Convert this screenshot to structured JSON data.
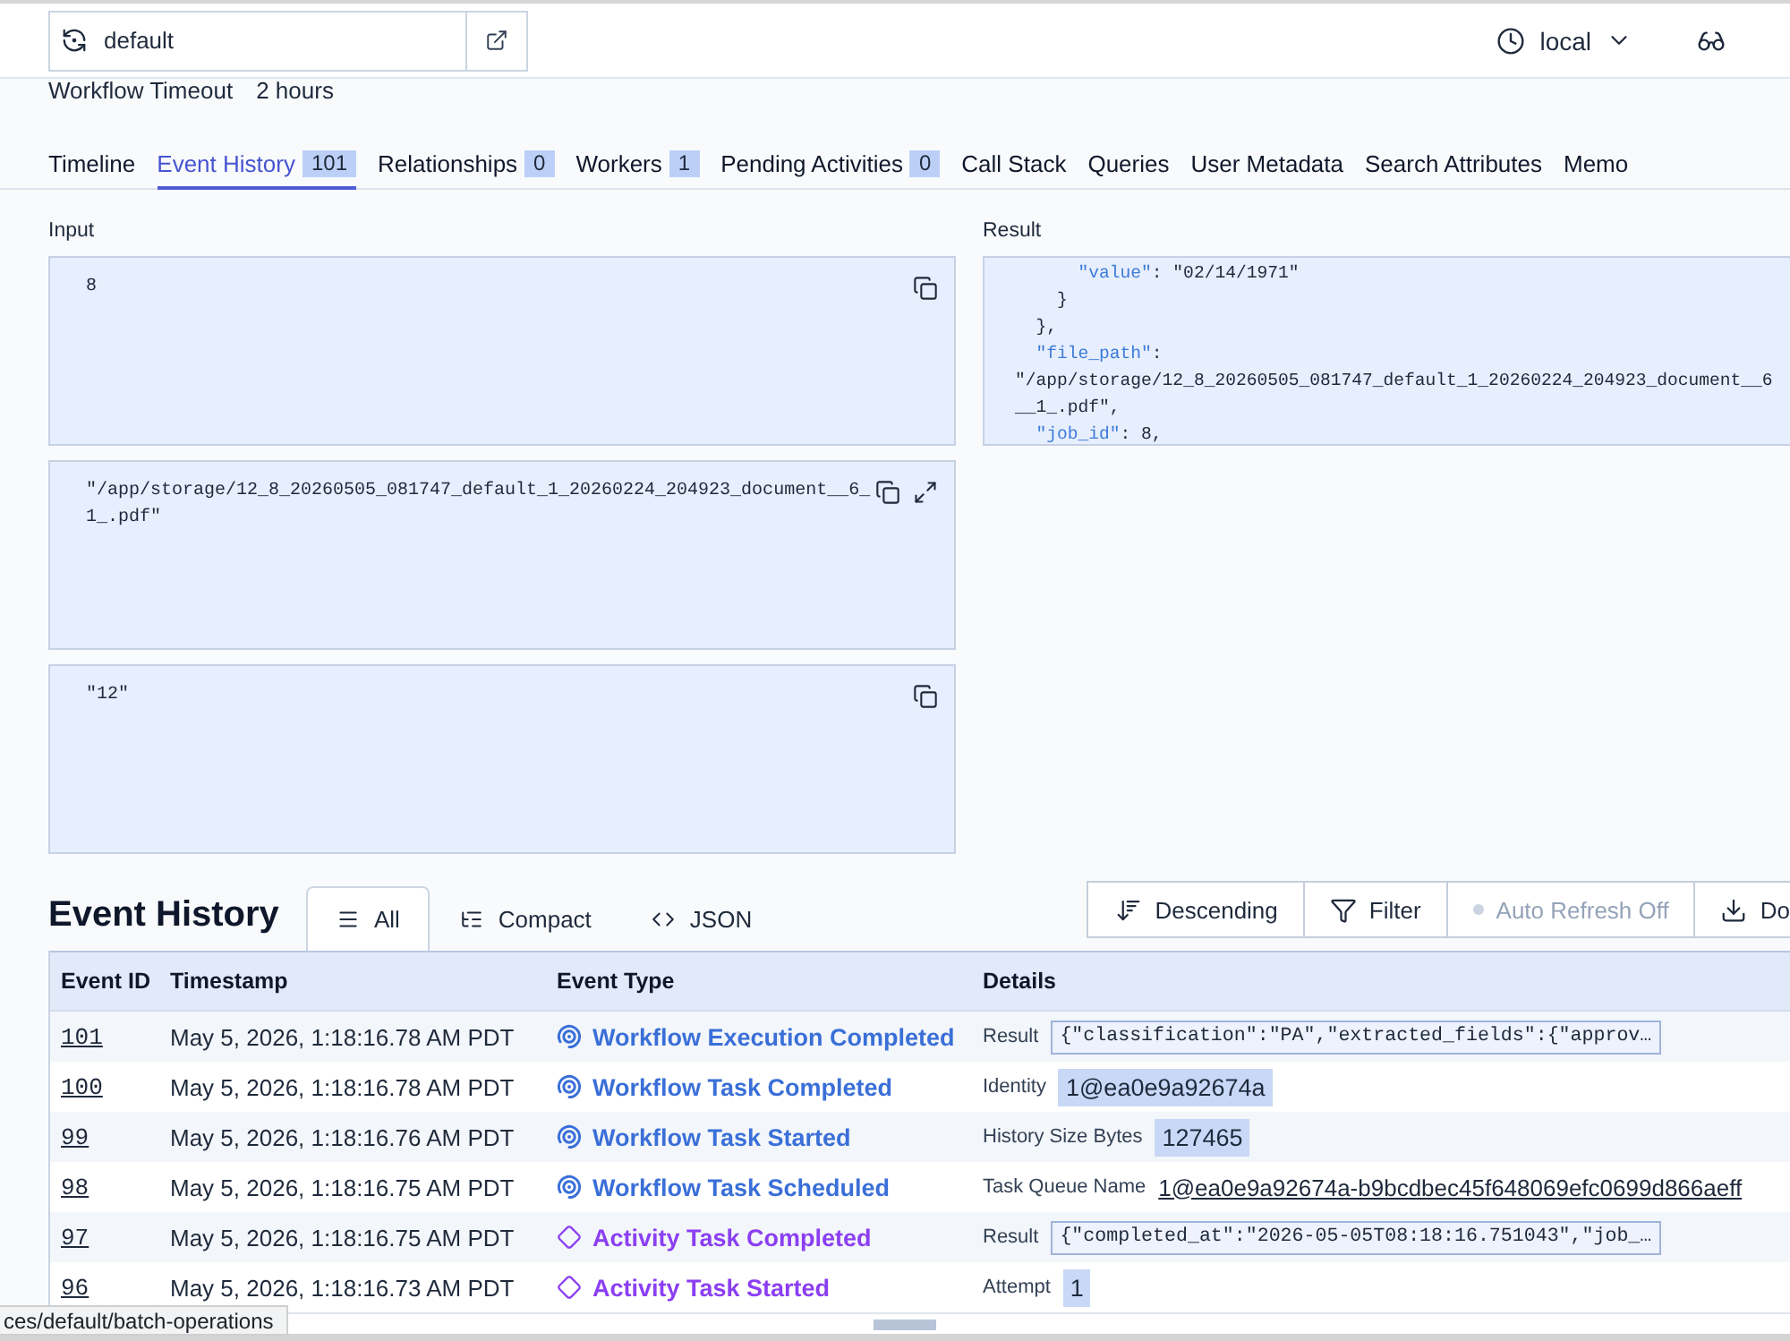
{
  "top_bar": {
    "namespace": "default",
    "timezone": "local"
  },
  "summary": [
    {
      "label": "Workflow Timeout",
      "value": "2 hours"
    }
  ],
  "tabs": [
    {
      "label": "Timeline",
      "selected": false
    },
    {
      "label": "Event History",
      "count": "101",
      "selected": true
    },
    {
      "label": "Relationships",
      "count": "0",
      "selected": false
    },
    {
      "label": "Workers",
      "count": "1",
      "selected": false
    },
    {
      "label": "Pending Activities",
      "count": "0",
      "selected": false
    },
    {
      "label": "Call Stack",
      "selected": false
    },
    {
      "label": "Queries",
      "selected": false
    },
    {
      "label": "User Metadata",
      "selected": false
    },
    {
      "label": "Search Attributes",
      "selected": false
    },
    {
      "label": "Memo",
      "selected": false
    }
  ],
  "input": {
    "label": "Input",
    "payloads": [
      {
        "value": "8",
        "expandable": false
      },
      {
        "value": "\"/app/storage/12_8_20260505_081747_default_1_20260224_204923_document__6_1_.pdf\"",
        "expandable": true
      },
      {
        "value": "\"12\"",
        "expandable": false
      }
    ]
  },
  "result": {
    "label": "Result",
    "lines": [
      "      \"value\": \"02/14/1971\"",
      "    }",
      "  },",
      "  \"file_path\":",
      "\"/app/storage/12_8_20260505_081747_default_1_20260224_204923_document__6",
      "__1_.pdf\",",
      "  \"job_id\": 8,"
    ]
  },
  "event_history": {
    "title": "Event History",
    "views": [
      {
        "label": "All",
        "selected": true
      },
      {
        "label": "Compact",
        "selected": false
      },
      {
        "label": "JSON",
        "selected": false
      }
    ],
    "actions": [
      {
        "label": "Descending",
        "kind": "sort",
        "disabled": false
      },
      {
        "label": "Filter",
        "kind": "filter",
        "disabled": false
      },
      {
        "label": "Auto Refresh Off",
        "kind": "toggle",
        "disabled": true
      },
      {
        "label": "Do",
        "kind": "download",
        "disabled": false
      }
    ],
    "columns": [
      "Event ID",
      "Timestamp",
      "Event Type",
      "Details"
    ],
    "rows": [
      {
        "id": "101",
        "timestamp": "May 5, 2026, 1:18:16.78 AM PDT",
        "event_type": "Workflow Execution Completed",
        "kind": "workflow",
        "detail": {
          "label": "Result",
          "value": "{\"classification\":\"PA\",\"extracted_fields\":{\"approv…",
          "kind": "code"
        }
      },
      {
        "id": "100",
        "timestamp": "May 5, 2026, 1:18:16.78 AM PDT",
        "event_type": "Workflow Task Completed",
        "kind": "workflow",
        "detail": {
          "label": "Identity",
          "value": "1@ea0e9a92674a",
          "kind": "chip"
        }
      },
      {
        "id": "99",
        "timestamp": "May 5, 2026, 1:18:16.76 AM PDT",
        "event_type": "Workflow Task Started",
        "kind": "workflow",
        "detail": {
          "label": "History Size Bytes",
          "value": "127465",
          "kind": "chip"
        }
      },
      {
        "id": "98",
        "timestamp": "May 5, 2026, 1:18:16.75 AM PDT",
        "event_type": "Workflow Task Scheduled",
        "kind": "workflow",
        "detail": {
          "label": "Task Queue Name",
          "value": "1@ea0e9a92674a-b9bcdbec45f648069efc0699d866aeff",
          "kind": "link"
        }
      },
      {
        "id": "97",
        "timestamp": "May 5, 2026, 1:18:16.75 AM PDT",
        "event_type": "Activity Task Completed",
        "kind": "activity",
        "detail": {
          "label": "Result",
          "value": "{\"completed_at\":\"2026-05-05T08:18:16.751043\",\"job_…",
          "kind": "code"
        }
      },
      {
        "id": "96",
        "timestamp": "May 5, 2026, 1:18:16.73 AM PDT",
        "event_type": "Activity Task Started",
        "kind": "activity",
        "detail": {
          "label": "Attempt",
          "value": "1",
          "kind": "chip"
        }
      }
    ]
  },
  "status_url": "ces/default/batch-operations"
}
